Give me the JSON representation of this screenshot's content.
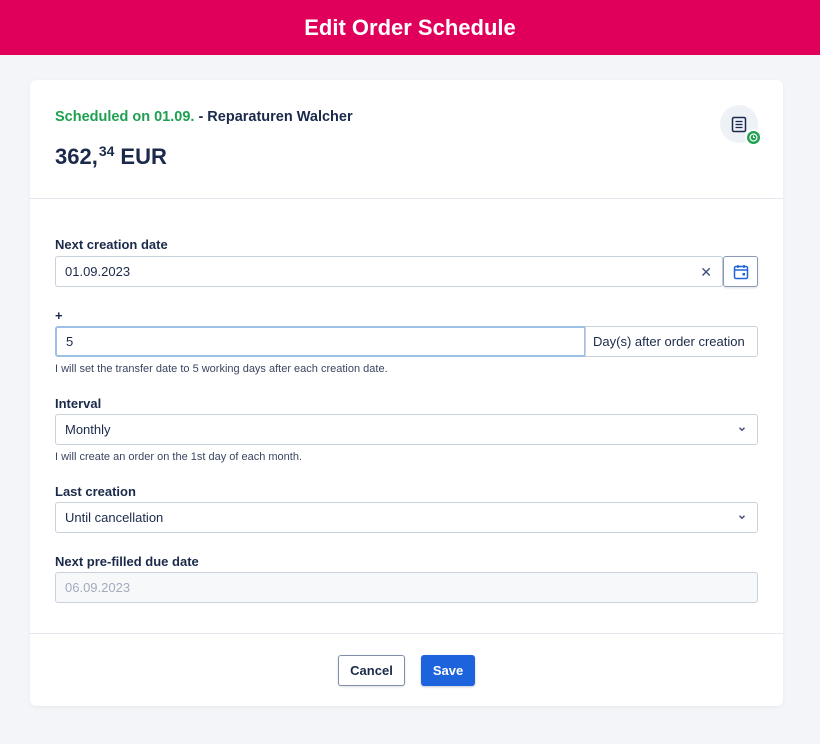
{
  "header": {
    "title": "Edit Order Schedule"
  },
  "summary": {
    "scheduled_text": "Scheduled on 01.09.",
    "vendor_text": "- Reparaturen Walcher",
    "amount_integer": "362,",
    "amount_decimal": "34",
    "currency": "EUR",
    "icon": "scheduled-document-icon",
    "status_color": "#1ea050"
  },
  "form": {
    "next_creation": {
      "label": "Next creation date",
      "value": "01.09.2023",
      "clear_symbol": "✕"
    },
    "offset": {
      "label": "+",
      "value": "5",
      "suffix": "Day(s) after order creation",
      "hint": "I will set the transfer date to 5 working days after each creation date."
    },
    "interval": {
      "label": "Interval",
      "value": "Monthly",
      "hint": "I will create an order on the 1st day of each month."
    },
    "last_creation": {
      "label": "Last creation",
      "value": "Until cancellation"
    },
    "due_date": {
      "label": "Next pre-filled due date",
      "value": "06.09.2023"
    }
  },
  "footer": {
    "cancel_label": "Cancel",
    "save_label": "Save"
  },
  "colors": {
    "brand": "#e0005b",
    "primary": "#1d63db",
    "success": "#1ea050"
  }
}
